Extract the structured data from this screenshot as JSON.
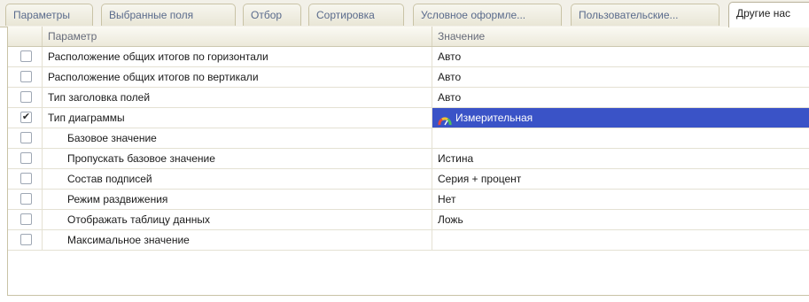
{
  "tabs": [
    {
      "label": "Параметры",
      "active": false
    },
    {
      "label": "Выбранные поля",
      "active": false
    },
    {
      "label": "Отбор",
      "active": false
    },
    {
      "label": "Сортировка",
      "active": false
    },
    {
      "label": "Условное оформле...",
      "active": false
    },
    {
      "label": "Пользовательские...",
      "active": false
    },
    {
      "label": "Другие нас",
      "active": true
    }
  ],
  "grid": {
    "header": {
      "parameter": "Параметр",
      "value": "Значение"
    },
    "rows": [
      {
        "label": "Расположение общих итогов по горизонтали",
        "value": "Авто",
        "checked": false,
        "child": false
      },
      {
        "label": "Расположение общих итогов по вертикали",
        "value": "Авто",
        "checked": false,
        "child": false
      },
      {
        "label": "Тип заголовка полей",
        "value": "Авто",
        "checked": false,
        "child": false
      },
      {
        "label": "Тип диаграммы",
        "value": "Измерительная",
        "checked": true,
        "child": false,
        "selected": true,
        "icon": "gauge-chart-icon"
      },
      {
        "label": "Базовое значение",
        "value": "",
        "checked": false,
        "child": true
      },
      {
        "label": "Пропускать базовое значение",
        "value": "Истина",
        "checked": false,
        "child": true
      },
      {
        "label": "Состав подписей",
        "value": "Серия + процент",
        "checked": false,
        "child": true
      },
      {
        "label": "Режим раздвижения",
        "value": "Нет",
        "checked": false,
        "child": true
      },
      {
        "label": "Отображать таблицу данных",
        "value": "Ложь",
        "checked": false,
        "child": true
      },
      {
        "label": "Максимальное значение",
        "value": "",
        "checked": false,
        "child": true
      }
    ]
  },
  "colors": {
    "selection": "#3a53c7",
    "tab_text": "#5a6b8c"
  }
}
